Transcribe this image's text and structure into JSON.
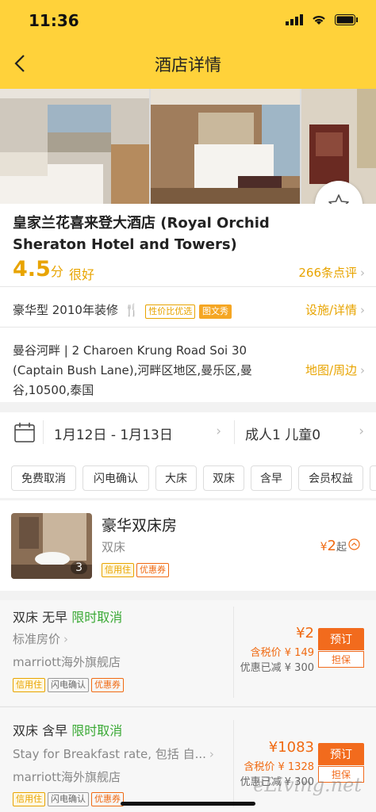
{
  "status_bar": {
    "time": "11:36"
  },
  "nav": {
    "title": "酒店详情"
  },
  "hotel": {
    "name": "皇家兰花喜来登大酒店 (Royal Orchid Sheraton Hotel and Towers)",
    "score": "4.5",
    "score_unit": "分",
    "score_text": "很好",
    "reviews": "266条点评",
    "room_type_info": "豪华型 2010年装修",
    "tag_value": "性价比优选",
    "tag_photo": "图文秀",
    "facilities_link": "设施/详情",
    "address": "曼谷河畔 | 2 Charoen Krung Road Soi 30 (Captain Bush Lane),河畔区地区,曼乐区,曼谷,10500,泰国",
    "map_link": "地图/周边"
  },
  "booking": {
    "dates": "1月12日 - 1月13日",
    "guests": "成人1 儿童0"
  },
  "filters": [
    "免费取消",
    "闪电确认",
    "大床",
    "双床",
    "含早",
    "会员权益"
  ],
  "room": {
    "name": "豪华双床房",
    "bed": "双床",
    "photo_count": "3",
    "tag_credit": "信用住",
    "tag_coupon": "优惠券",
    "price_symbol": "¥",
    "price": "2",
    "price_suffix": "起"
  },
  "rates": [
    {
      "title": "双床 无早",
      "cancel": "限时取消",
      "desc": "标准房价",
      "seller": "marriott海外旗舰店",
      "tags": [
        "信用住",
        "闪电确认",
        "优惠券"
      ],
      "price": "¥2",
      "tax_price": "含税价 ¥ 149",
      "discount": "优惠已减 ¥ 300",
      "book": "预订",
      "guarantee": "担保"
    },
    {
      "title": "双床 含早",
      "cancel": "限时取消",
      "desc": "Stay for Breakfast rate, 包括 自...",
      "seller": "marriott海外旗舰店",
      "tags": [
        "信用住",
        "闪电确认",
        "优惠券"
      ],
      "price": "¥1083",
      "tax_price": "含税价 ¥ 1328",
      "discount": "优惠已减 ¥ 300",
      "book": "预订",
      "guarantee": "担保"
    }
  ],
  "watermark": "eLiving.net",
  "colors": {
    "brand_yellow": "#ffd23a",
    "accent_orange": "#f06a12",
    "green": "#3aa935",
    "score_gold": "#e8a400"
  }
}
